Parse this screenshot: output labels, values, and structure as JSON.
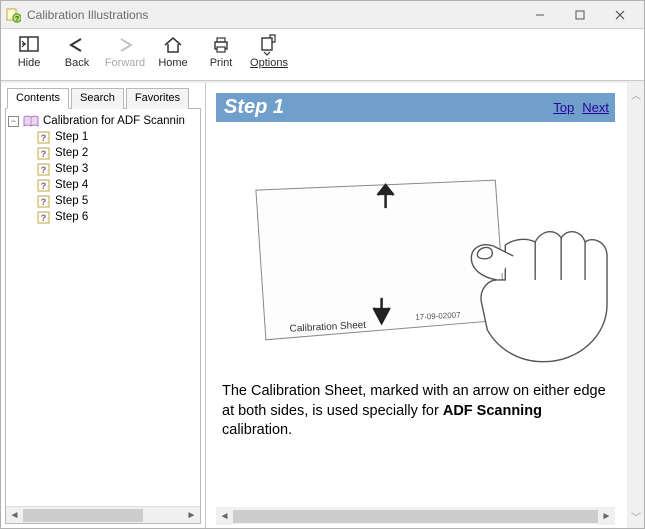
{
  "window": {
    "title": "Calibration Illustrations"
  },
  "toolbar": {
    "hide": "Hide",
    "back": "Back",
    "forward": "Forward",
    "home": "Home",
    "print": "Print",
    "options": "Options"
  },
  "tabs": {
    "contents": "Contents",
    "search": "Search",
    "favorites": "Favorites"
  },
  "tree": {
    "root": "Calibration for ADF Scannin",
    "items": [
      {
        "label": "Step 1"
      },
      {
        "label": "Step 2"
      },
      {
        "label": "Step 3"
      },
      {
        "label": "Step 4"
      },
      {
        "label": "Step 5"
      },
      {
        "label": "Step 6"
      }
    ]
  },
  "content": {
    "heading": "Step 1",
    "top_link": "Top",
    "next_link": "Next",
    "sheet_label": "Calibration Sheet",
    "sheet_code": "17-09-02007",
    "desc_1": "The Calibration Sheet, marked with an arrow on either edge at both sides, is used specially for ",
    "desc_bold": "ADF Scanning",
    "desc_2": " calibration."
  }
}
